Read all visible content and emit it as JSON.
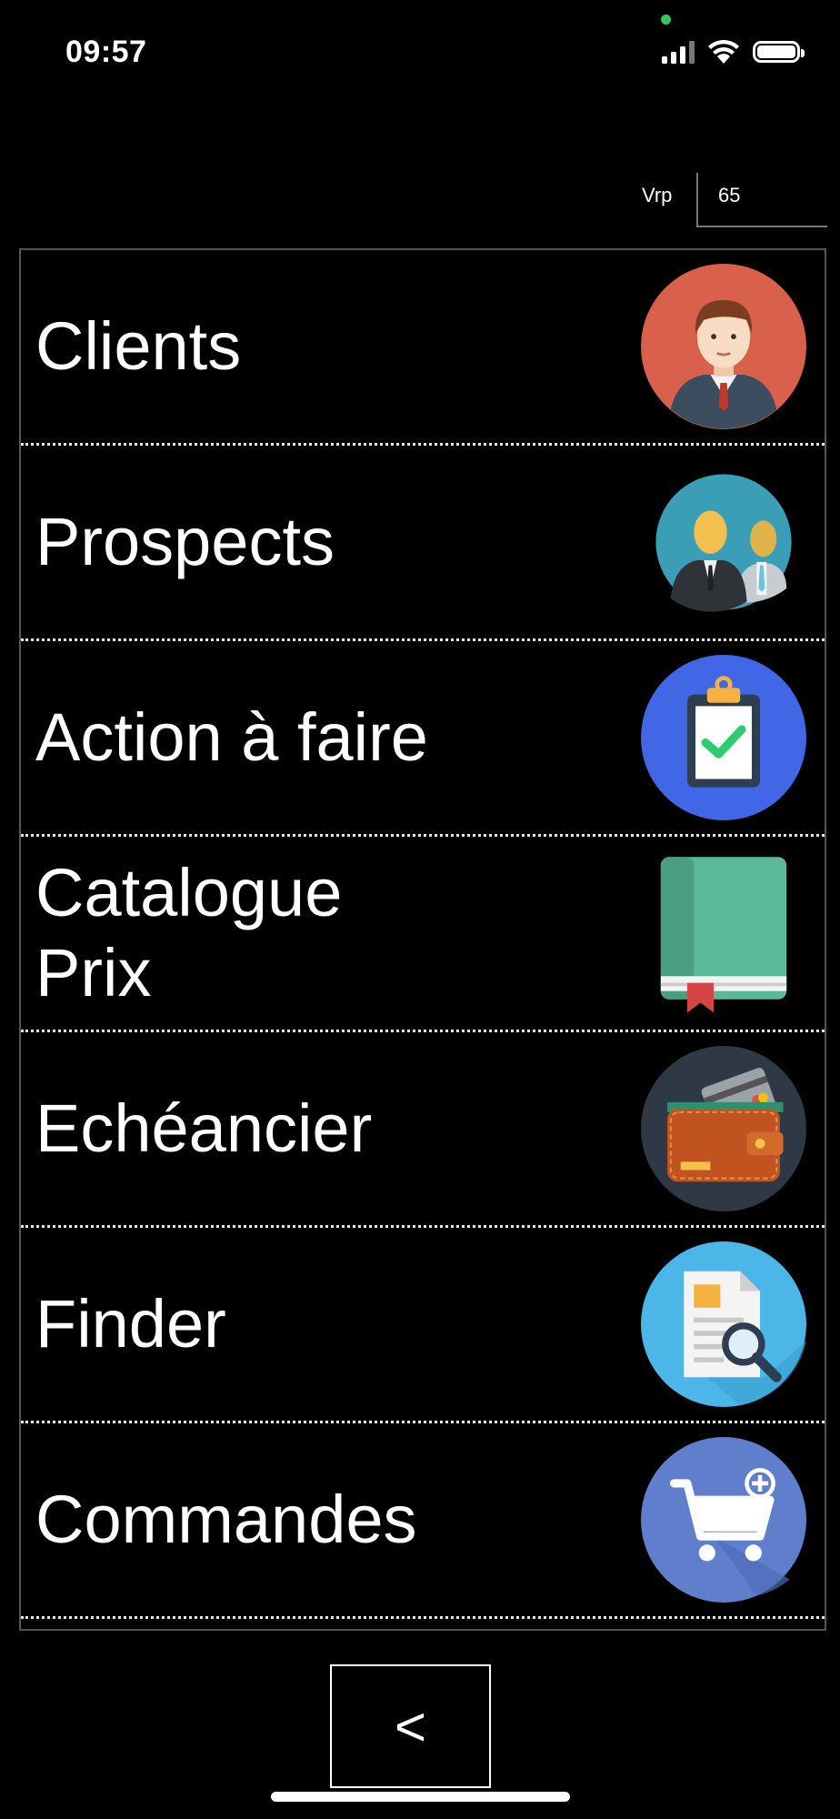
{
  "status_bar": {
    "time": "09:57"
  },
  "vrp": {
    "label": "Vrp",
    "value": "65"
  },
  "menu": {
    "items": [
      {
        "label": "Clients",
        "icon": "client-avatar-icon"
      },
      {
        "label": "Prospects",
        "icon": "prospects-people-icon"
      },
      {
        "label": "Action à faire",
        "icon": "clipboard-check-icon"
      },
      {
        "label": "Catalogue\nPrix",
        "icon": "catalogue-book-icon"
      },
      {
        "label": "Echéancier",
        "icon": "wallet-icon"
      },
      {
        "label": "Finder",
        "icon": "document-search-icon"
      },
      {
        "label": "Commandes",
        "icon": "shopping-cart-add-icon"
      }
    ]
  },
  "back_button": {
    "label": "<"
  },
  "colors": {
    "background": "#000000",
    "clients_circle": "#d9604b",
    "prospects_circle": "#3a9fb6",
    "action_circle": "#4267e6",
    "book_green": "#5bb99a",
    "wallet_circle": "#2f3946",
    "finder_circle": "#4db6e8",
    "commandes_circle": "#5f7fcc"
  }
}
